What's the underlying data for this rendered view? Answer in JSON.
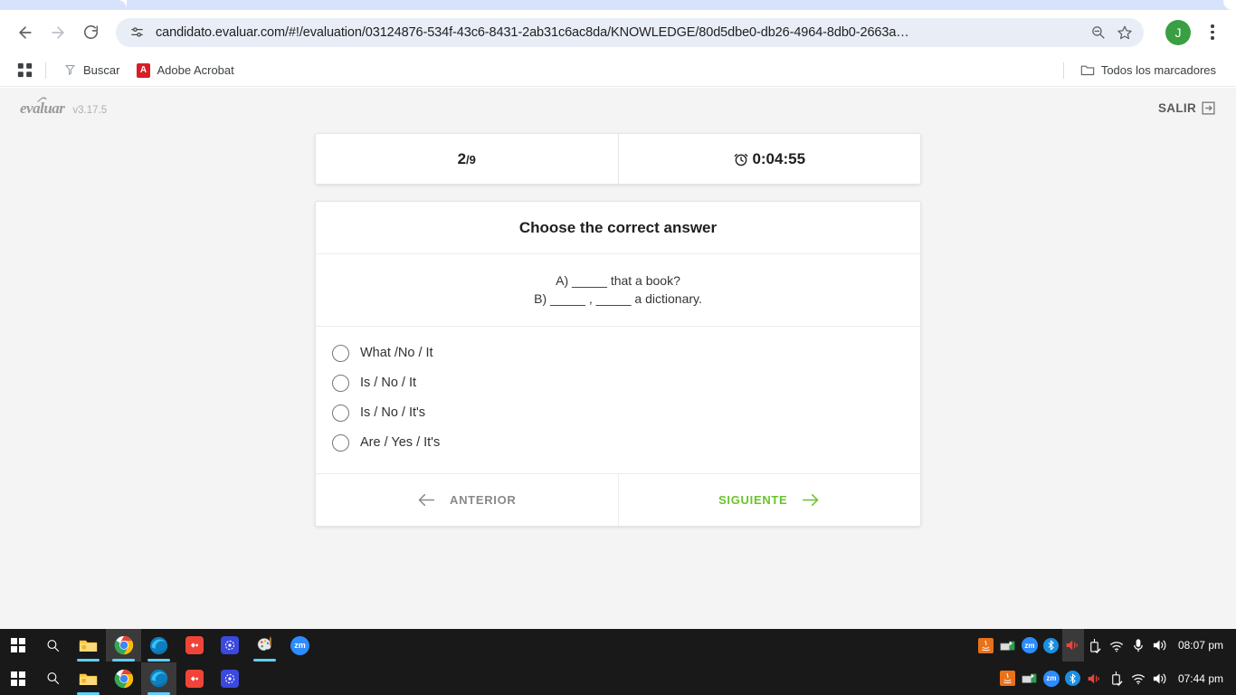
{
  "browser": {
    "back_icon": "back-arrow-icon",
    "forward_icon": "forward-arrow-icon",
    "reload_icon": "reload-icon",
    "site_info_icon": "site-settings-icon",
    "url": "candidato.evaluar.com/#!/evaluation/03124876-534f-43c6-8431-2ab31c6ac8da/KNOWLEDGE/80d5dbe0-db26-4964-8db0-2663a…",
    "zoom_icon": "zoom-out-icon",
    "bookmark_icon": "star-icon",
    "profile_initial": "J",
    "menu_icon": "kebab-menu-icon",
    "profile_color": "#3a9e42"
  },
  "bookmarks": {
    "apps_icon": "apps-grid-icon",
    "items": [
      {
        "label": "Buscar",
        "icon": "search-bookmark-icon"
      },
      {
        "label": "Adobe Acrobat",
        "icon": "adobe-acrobat-icon"
      }
    ],
    "all_bookmarks": {
      "label": "Todos los marcadores",
      "icon": "folder-icon"
    }
  },
  "app": {
    "logo_text": "evaluar",
    "version": "v3.17.5",
    "logout": {
      "label": "SALIR",
      "icon": "logout-icon"
    }
  },
  "status": {
    "question_number": "2",
    "separator": "/",
    "question_total": "9",
    "timer_icon": "alarm-clock-icon",
    "timer": "0:04:55"
  },
  "question": {
    "title": "Choose the correct answer",
    "line_a": "A) _____ that a book?",
    "line_b": "B) _____ , _____ a dictionary.",
    "options": [
      {
        "label": "What /No / It",
        "selected": false
      },
      {
        "label": "Is / No / It",
        "selected": false
      },
      {
        "label": "Is / No / It's",
        "selected": false
      },
      {
        "label": "Are / Yes / It's",
        "selected": false
      }
    ]
  },
  "navigation": {
    "previous": {
      "label": "ANTERIOR",
      "icon": "arrow-left-icon",
      "color": "#8a8a8a"
    },
    "next": {
      "label": "SIGUIENTE",
      "icon": "arrow-right-icon",
      "color": "#6ac32b"
    }
  },
  "taskbar_primary": {
    "start_icon": "windows-start-icon",
    "items": [
      {
        "name": "search-icon"
      },
      {
        "name": "file-explorer-icon"
      },
      {
        "name": "google-chrome-icon"
      },
      {
        "name": "microsoft-edge-icon"
      },
      {
        "name": "red-app-icon"
      },
      {
        "name": "blue-chat-app-icon"
      },
      {
        "name": "paint-app-icon"
      },
      {
        "name": "zoom-app-icon"
      }
    ],
    "tray": [
      {
        "name": "java-icon"
      },
      {
        "name": "fax-printer-icon"
      },
      {
        "name": "zoom-tray-icon"
      },
      {
        "name": "bluetooth-icon"
      },
      {
        "name": "volume-muted-icon"
      },
      {
        "name": "usb-safely-remove-icon"
      },
      {
        "name": "wifi-icon"
      },
      {
        "name": "microphone-icon"
      },
      {
        "name": "speaker-icon"
      }
    ],
    "clock": "08:07 pm"
  },
  "taskbar_secondary": {
    "start_icon": "windows-start-icon",
    "items": [
      {
        "name": "search-icon"
      },
      {
        "name": "file-explorer-icon"
      },
      {
        "name": "google-chrome-icon"
      },
      {
        "name": "microsoft-edge-icon"
      },
      {
        "name": "red-app-icon"
      },
      {
        "name": "blue-chat-app-icon"
      }
    ],
    "tray": [
      {
        "name": "java-icon"
      },
      {
        "name": "fax-printer-icon"
      },
      {
        "name": "zoom-tray-icon"
      },
      {
        "name": "bluetooth-icon"
      },
      {
        "name": "volume-muted-icon"
      },
      {
        "name": "usb-safely-remove-icon"
      },
      {
        "name": "wifi-icon"
      },
      {
        "name": "speaker-icon"
      }
    ],
    "clock": "07:44 pm"
  }
}
